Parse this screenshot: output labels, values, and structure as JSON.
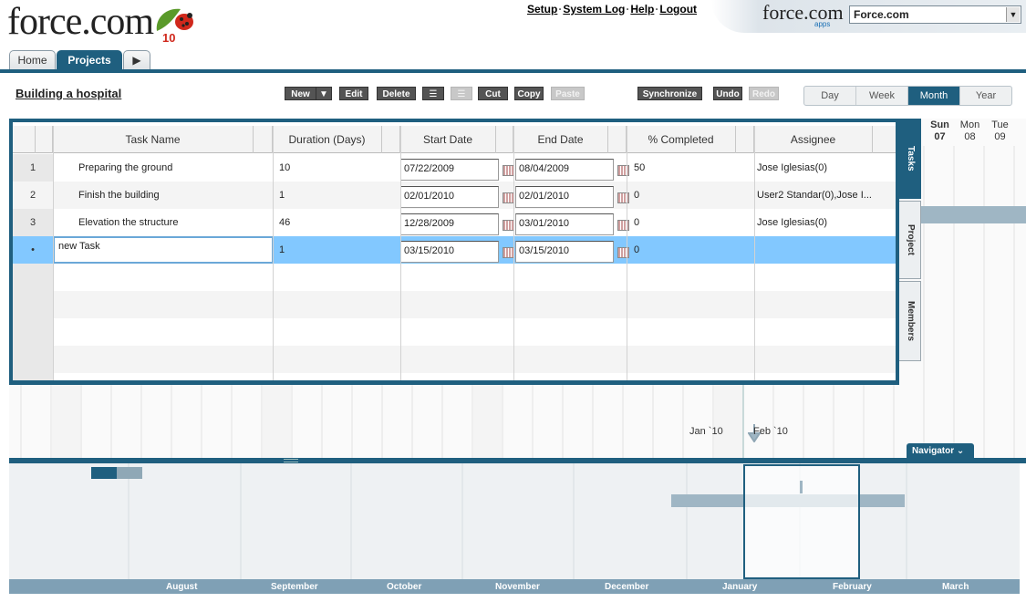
{
  "header": {
    "logo_text": "force.com",
    "logo_badge": "10",
    "links": [
      "Setup",
      "System Log",
      "Help",
      "Logout"
    ],
    "brand_text": "force.com",
    "brand_sub": "apps",
    "app_selector": "Force.com"
  },
  "tabs": [
    {
      "label": "Home"
    },
    {
      "label": "Projects"
    }
  ],
  "project_title": "Building a hospital",
  "toolbar": {
    "new": "New",
    "edit": "Edit",
    "delete": "Delete",
    "cut": "Cut",
    "copy": "Copy",
    "paste": "Paste",
    "synchronize": "Synchronize",
    "undo": "Undo",
    "redo": "Redo"
  },
  "view_tabs": [
    "Day",
    "Week",
    "Month",
    "Year"
  ],
  "selected_view": "Month",
  "grid": {
    "columns": [
      "Task Name",
      "Duration (Days)",
      "Start Date",
      "End Date",
      "% Completed",
      "Assignee"
    ],
    "rows": [
      {
        "num": "1",
        "task": "Preparing the ground",
        "duration": "10",
        "start": "07/22/2009",
        "end": "08/04/2009",
        "completed": "50",
        "assignee": "Jose Iglesias(0)"
      },
      {
        "num": "2",
        "task": "Finish the building",
        "duration": "1",
        "start": "02/01/2010",
        "end": "02/01/2010",
        "completed": "0",
        "assignee": "User2 Standar(0),Jose I..."
      },
      {
        "num": "3",
        "task": "Elevation the structure",
        "duration": "46",
        "start": "12/28/2009",
        "end": "03/01/2010",
        "completed": "0",
        "assignee": "Jose Iglesias(0)"
      },
      {
        "num": "•",
        "task": "new Task",
        "duration": "1",
        "start": "03/15/2010",
        "end": "03/15/2010",
        "completed": "0",
        "assignee": ""
      }
    ]
  },
  "side_tabs": [
    "Tasks",
    "Project",
    "Members"
  ],
  "gantt_dates": [
    {
      "day": "Sun",
      "num": "07"
    },
    {
      "day": "Mon",
      "num": "08"
    },
    {
      "day": "Tue",
      "num": "09"
    }
  ],
  "gantt_months": [
    "Jan `10",
    "Feb `10"
  ],
  "navigator": {
    "label": "Navigator",
    "months": [
      "August",
      "September",
      "October",
      "November",
      "December",
      "January",
      "February",
      "March"
    ]
  }
}
